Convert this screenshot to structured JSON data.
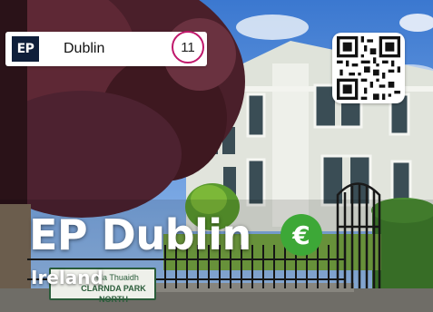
{
  "header": {
    "logo_text": "EP",
    "city": "Dublin",
    "count": "11"
  },
  "hero": {
    "title": "EP Dublin",
    "currency_symbol": "€",
    "country": "Ireland"
  },
  "street_sign": {
    "irish": "nda Thuaidh",
    "english": "CLARNDA PARK NORTH"
  },
  "icons": {
    "qr": "qr-code-icon",
    "currency": "euro-icon"
  },
  "colors": {
    "logo_bg": "#0f1f3a",
    "count_ring": "#c0186b",
    "currency_badge": "#3da837"
  }
}
